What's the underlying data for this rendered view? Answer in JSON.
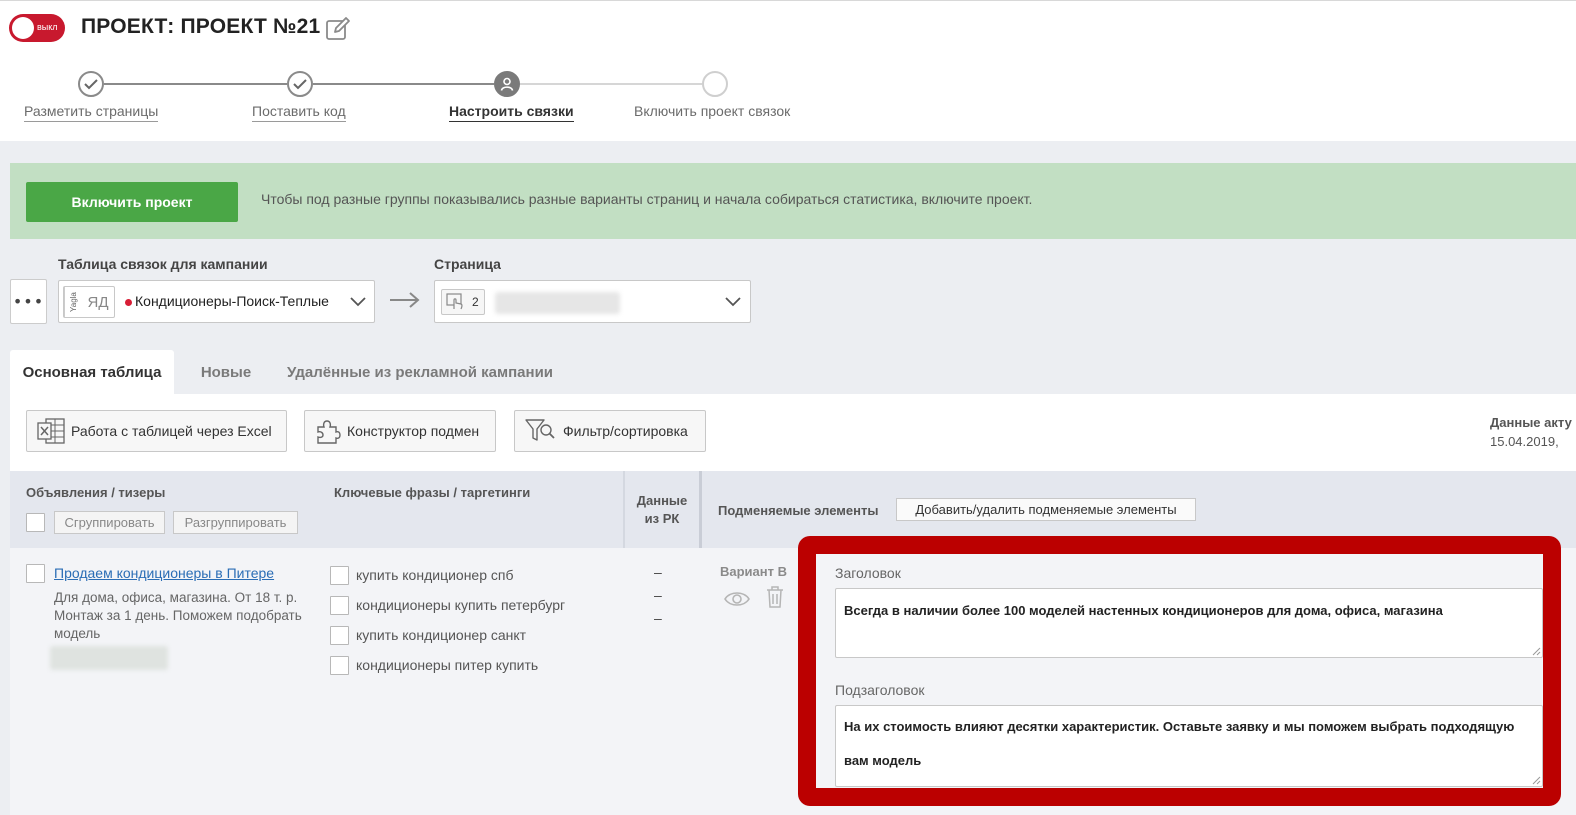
{
  "header": {
    "toggle_label": "выкл",
    "project_title": "ПРОЕКТ: ПРОЕКТ №21"
  },
  "stepper": {
    "steps": [
      {
        "label": "Разметить страницы",
        "state": "done"
      },
      {
        "label": "Поставить код",
        "state": "done"
      },
      {
        "label": "Настроить связки",
        "state": "active"
      },
      {
        "label": "Включить проект связок",
        "state": "todo"
      }
    ]
  },
  "banner": {
    "button_label": "Включить проект",
    "text": "Чтобы под разные группы показывались разные варианты страниц и начала собираться статистика, включите проект."
  },
  "selectors": {
    "campaign_label": "Таблица связок для кампании",
    "source_yagla": "Yagla",
    "source_yd": "ЯД",
    "campaign_value": "Кондиционеры-Поиск-Теплые",
    "page_label": "Страница",
    "page_count": "2"
  },
  "tabs": [
    {
      "label": "Основная таблица",
      "active": true
    },
    {
      "label": "Новые",
      "active": false
    },
    {
      "label": "Удалённые из рекламной кампании",
      "active": false
    }
  ],
  "toolbar": {
    "excel_label": "Работа с таблицей через Excel",
    "constructor_label": "Конструктор подмен",
    "filter_label": "Фильтр/сортировка",
    "data_actual_label": "Данные акту",
    "data_actual_date": "15.04.2019,"
  },
  "table": {
    "col_ads": "Объявления / тизеры",
    "group_label": "Сгруппировать",
    "ungroup_label": "Разгруппировать",
    "col_keywords": "Ключевые фразы / таргетинги",
    "col_data_line1": "Данные",
    "col_data_line2": "из РК",
    "col_replaced": "Подменяемые элементы",
    "add_remove_label": "Добавить/удалить подменяемые элементы"
  },
  "row": {
    "ad_title": "Продаем кондиционеры в Питере",
    "ad_desc": "Для дома, офиса, магазина. От 18 т. р. Монтаж за 1 день. Поможем подобрать модель",
    "keywords": [
      "купить кондиционер спб",
      "кондиционеры купить петербург",
      "купить кондиционер санкт",
      "кондиционеры питер купить"
    ],
    "data_values": [
      "–",
      "–",
      "–"
    ],
    "variant_label": "Вариант В",
    "headline_label": "Заголовок",
    "headline_value": "Всегда в наличии более 100 моделей настенных кондиционеров для дома, офиса, магазина",
    "subheadline_label": "Подзаголовок",
    "subheadline_value": "На их стоимость влияют десятки характеристик. Оставьте заявку и мы поможем выбрать подходящую вам модель"
  },
  "colors": {
    "toggle_red": "#c8192e",
    "banner_green": "#c2dfc3",
    "button_green": "#4aa746",
    "highlight_red": "#bb0000",
    "link_blue": "#2a6db5"
  }
}
